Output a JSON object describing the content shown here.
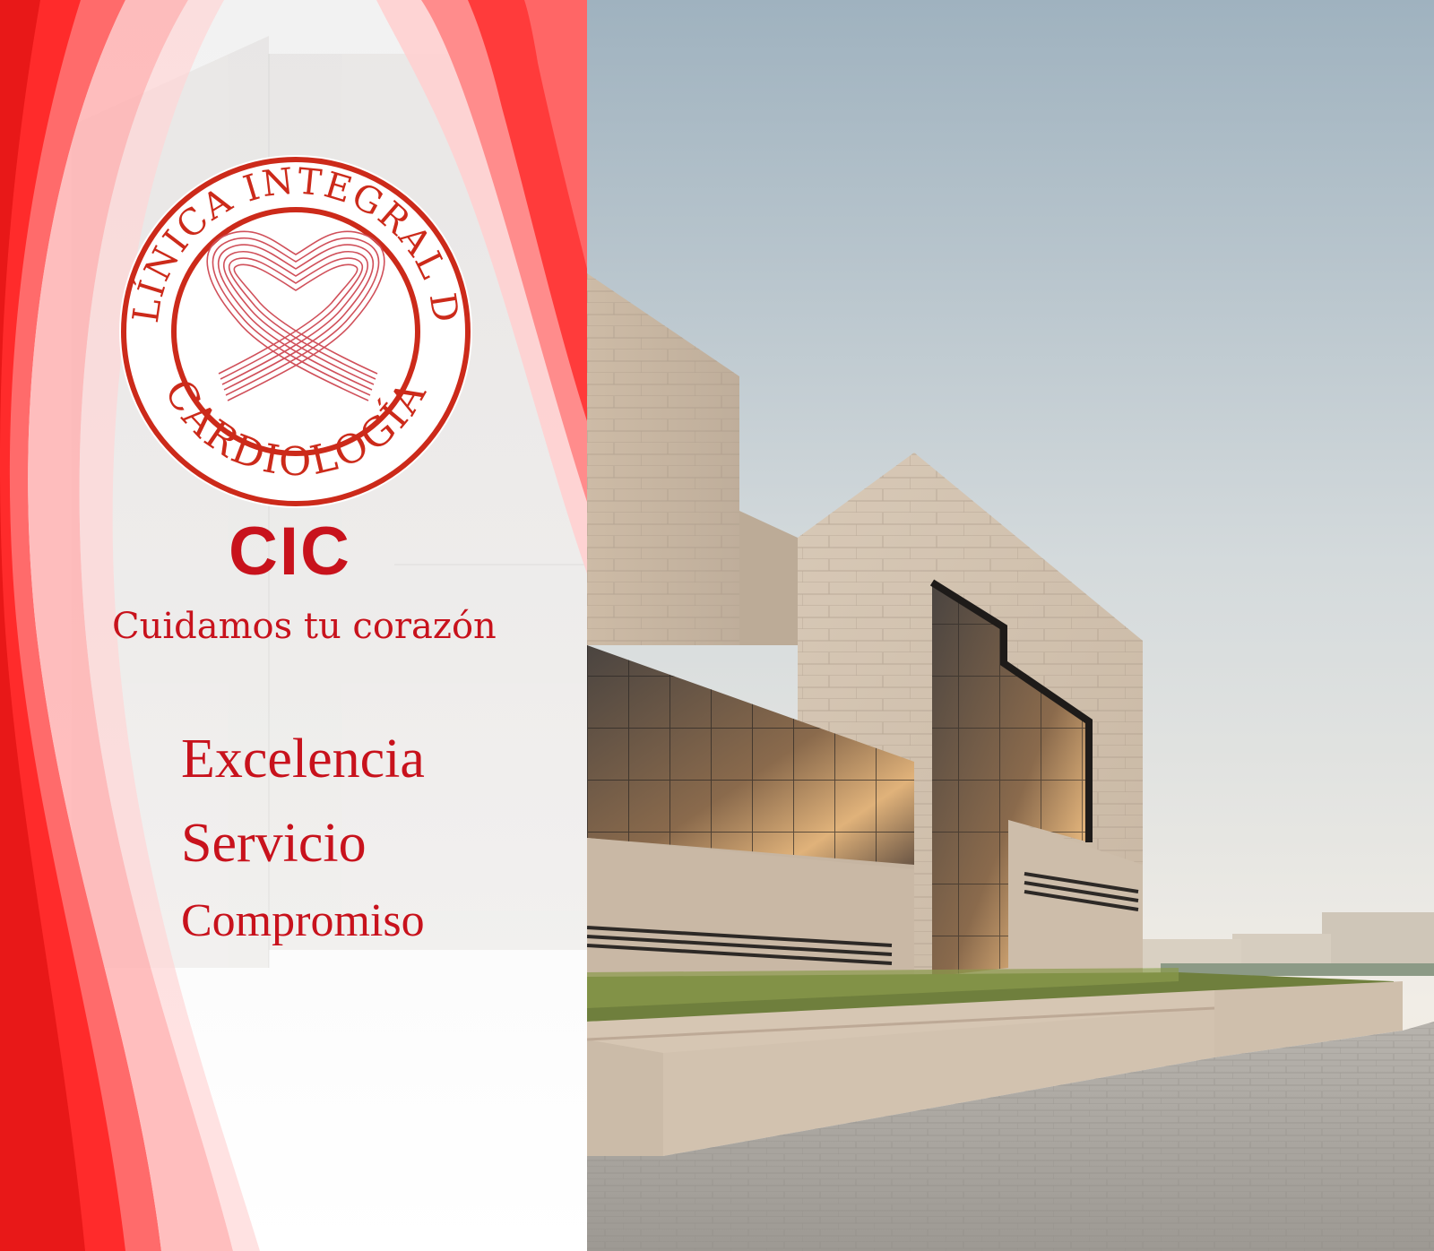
{
  "logo": {
    "ring_text_top": "CLÍNICA INTEGRAL DE",
    "ring_text_bottom": "CARDIOLOGÍA",
    "symbol": "heart-ribbon-icon"
  },
  "brand": {
    "acronym": "CIC",
    "tagline": "Cuidamos tu corazón"
  },
  "values": [
    "Excelencia",
    "Servicio",
    "Compromiso"
  ],
  "colors": {
    "brand_red": "#c8121c",
    "accent_red": "#ff1f1f",
    "soft_red": "#ff8a8a",
    "stone": "#d9c8b6"
  },
  "photo": {
    "subject": "modern-clinic-building-photo"
  }
}
